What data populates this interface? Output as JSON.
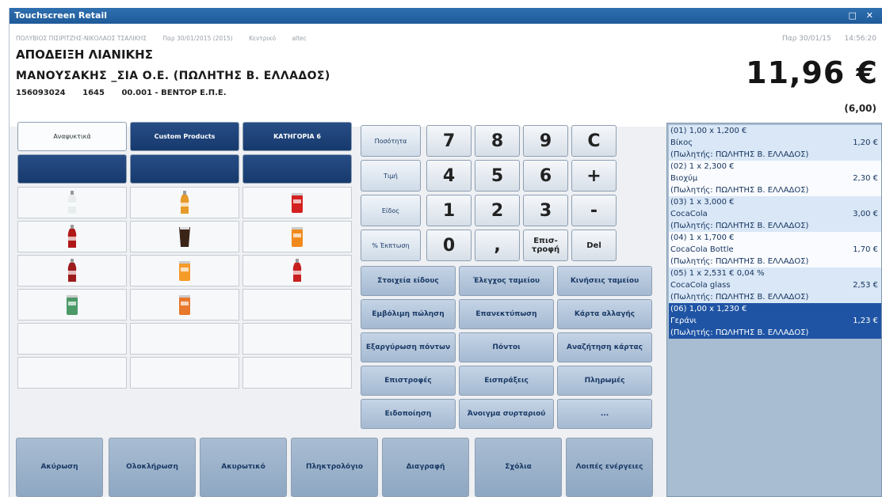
{
  "window": {
    "title": "Touchscreen Retail",
    "controls": "□ ✕"
  },
  "header": {
    "info": [
      "ΠΟΛΥΒΙΟΣ ΠΙΣΙΡΙΤΖΗΣ-ΝΙΚΟΛΑΟΣ ΤΣΑΛΙΚΗΣ",
      "Παρ 30/01/2015 (2015)",
      "Κεντρικό",
      "altec"
    ],
    "doc_title": "ΑΠΟΔΕΙΞΗ ΛΙΑΝΙΚΗΣ",
    "customer": "ΜΑΝΟΥΣΑΚΗΣ _ΣΙΑ Ο.Ε.   (ΠΩΛΗΤΗΣ Β. ΕΛΛΑΔΟΣ)",
    "codes": [
      "156093024",
      "1645",
      "00.001 - ΒΕΝΤΟΡ Ε.Π.Ε."
    ],
    "date": "Παρ 30/01/15",
    "time": "14:56:20",
    "total": "11,96 €",
    "subtotal": "(6,00)"
  },
  "categories": [
    "Αναψυκτικά",
    "Custom Products",
    "ΚΑΤΗΓΟΡΙΑ 6"
  ],
  "products": [
    {
      "icon": "water-bottle-icon",
      "color": "#e8eef0"
    },
    {
      "icon": "juice-bottle-icon",
      "color": "#e69a2a"
    },
    {
      "icon": "cola-can-icon",
      "color": "#d32020"
    },
    {
      "icon": "cola-bottle-icon",
      "color": "#b01818"
    },
    {
      "icon": "cola-glass-icon",
      "color": "#3a2418"
    },
    {
      "icon": "fanta-can-icon",
      "color": "#f08a1c"
    },
    {
      "icon": "cola-bottle-icon",
      "color": "#9e1c1c"
    },
    {
      "icon": "fanta-can-icon",
      "color": "#f59b2a"
    },
    {
      "icon": "red-bottle-icon",
      "color": "#c82020"
    },
    {
      "icon": "sprite-can-icon",
      "color": "#4c9a68"
    },
    {
      "icon": "fanta-cup-icon",
      "color": "#e8782c"
    }
  ],
  "keypad": {
    "side": [
      "Ποσότητα",
      "Τιμή",
      "Είδος",
      "% Έκπτωση"
    ],
    "rows": [
      [
        "7",
        "8",
        "9",
        "C"
      ],
      [
        "4",
        "5",
        "6",
        "+"
      ],
      [
        "1",
        "2",
        "3",
        "-"
      ],
      [
        "0",
        ",",
        "Επισ-τροφή",
        "Del"
      ]
    ]
  },
  "functions": [
    [
      "Στοιχεία είδους",
      "Έλεγχος ταμείου",
      "Κινήσεις ταμείου"
    ],
    [
      "Εμβόλιμη πώληση",
      "Επανεκτύπωση",
      "Κάρτα αλλαγής"
    ],
    [
      "Εξαργύρωση πόντων",
      "Πόντοι",
      "Αναζήτηση κάρτας"
    ],
    [
      "Επιστροφές",
      "Εισπράξεις",
      "Πληρωμές"
    ],
    [
      "Ειδοποίηση",
      "Άνοιγμα συρταριού",
      "..."
    ]
  ],
  "bottom": [
    "Ακύρωση",
    "Ολοκλήρωση",
    "Ακυρωτικό",
    "Πληκτρολόγιο",
    "Διαγραφή",
    "Σχόλια",
    "Λοιπές ενέργειες"
  ],
  "receipt": [
    {
      "header": "(01)   1,00 x 1,200 €",
      "name": "Βίκος",
      "amount": "1,20 €",
      "seller": "(Πωλητής: ΠΩΛΗΤΗΣ Β. ΕΛΛΑΔΟΣ)",
      "style": "blue"
    },
    {
      "header": "(02)   1 x 2,300 €",
      "name": "Βιοχύμ",
      "amount": "2,30 €",
      "seller": "(Πωλητής: ΠΩΛΗΤΗΣ Β. ΕΛΛΑΔΟΣ)",
      "style": "white"
    },
    {
      "header": "(03)   1 x 3,000 €",
      "name": "CocaCola",
      "amount": "3,00 €",
      "seller": "(Πωλητής: ΠΩΛΗΤΗΣ Β. ΕΛΛΑΔΟΣ)",
      "style": "blue"
    },
    {
      "header": "(04)   1 x 1,700 €",
      "name": "CocaCola Bottle",
      "amount": "1,70 €",
      "seller": "(Πωλητής: ΠΩΛΗΤΗΣ Β. ΕΛΛΑΔΟΣ)",
      "style": "white"
    },
    {
      "header": "(05)   1 x 2,531 €   0,04 %",
      "name": "CocaCola glass",
      "amount": "2,53 €",
      "seller": "(Πωλητής: ΠΩΛΗΤΗΣ Β. ΕΛΛΑΔΟΣ)",
      "style": "blue"
    },
    {
      "header": "(06)   1,00 x 1,230 €",
      "name": "Γεράνι",
      "amount": "1,23 €",
      "seller": "(Πωλητής: ΠΩΛΗΤΗΣ Β. ΕΛΛΑΔΟΣ)",
      "style": "sel"
    }
  ]
}
